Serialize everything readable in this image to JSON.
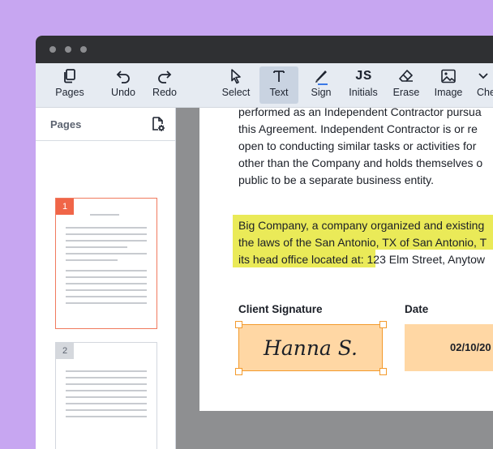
{
  "toolbar": {
    "pages": "Pages",
    "undo": "Undo",
    "redo": "Redo",
    "select": "Select",
    "text": "Text",
    "sign": "Sign",
    "initials": "Initials",
    "erase": "Erase",
    "image": "Image",
    "check": "Che"
  },
  "sidebar": {
    "title": "Pages",
    "pages": [
      {
        "number": "1",
        "active": true
      },
      {
        "number": "2",
        "active": false
      }
    ]
  },
  "document": {
    "paragraph1": [
      "performed as an Independent Contractor pursua",
      "this Agreement. Independent Contractor is or re",
      "open to conducting similar tasks or activities for",
      "other than the Company and holds themselves o",
      "public to be a separate business entity."
    ],
    "paragraph2": [
      "Big Company, a company organized and existing",
      "the laws of the San Antonio, TX of San Antonio, T",
      "its head office located at:"
    ],
    "paragraph2_address": " 123 Elm Street, Anytow",
    "client_signature_label": "Client Signature",
    "date_label": "Date",
    "signature": "Hanna S.",
    "date_value": "02/10/20"
  },
  "colors": {
    "background": "#c7a6f1",
    "highlight": "#eaea58",
    "field_fill": "#ffd7a4",
    "field_border": "#f39a2c",
    "page_active_accent": "#f06548"
  }
}
